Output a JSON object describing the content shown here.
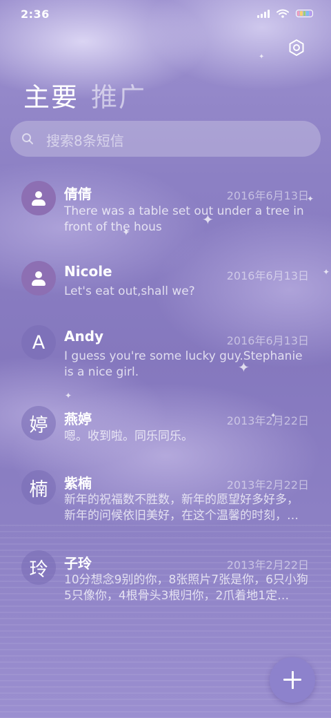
{
  "status_bar": {
    "time": "2:36"
  },
  "tabs": [
    {
      "label": "主要"
    },
    {
      "label": "推广"
    }
  ],
  "search": {
    "placeholder": "搜索8条短信"
  },
  "messages": [
    {
      "name": "倩倩",
      "date": "2016年6月13日",
      "preview": "There was a table set out under a tree in front of the hous",
      "avatar_type": "person",
      "avatar_text": ""
    },
    {
      "name": "Nicole",
      "date": "2016年6月13日",
      "preview": "Let's eat out,shall we?",
      "avatar_type": "person",
      "avatar_text": ""
    },
    {
      "name": "Andy",
      "date": "2016年6月13日",
      "preview": "I guess you're some lucky guy.Stephanie is a nice girl.",
      "avatar_type": "letter",
      "avatar_text": "A"
    },
    {
      "name": "燕婷",
      "date": "2013年2月22日",
      "preview": "嗯。收到啦。同乐同乐。",
      "avatar_type": "letter",
      "avatar_text": "婷"
    },
    {
      "name": "紫楠",
      "date": "2013年2月22日",
      "preview": "新年的祝福数不胜数，新年的愿望好多好多，新年的问候依旧美好，在这个温馨的时刻，…",
      "avatar_type": "letter",
      "avatar_text": "楠"
    },
    {
      "name": "子玲",
      "date": "2013年2月22日",
      "preview": "10分想念9别的你，8张照片7张是你，6只小狗5只像你，4根骨头3根归你，2爪着地1定…",
      "avatar_type": "letter",
      "avatar_text": "玲"
    }
  ],
  "icons": {
    "settings": "settings-icon",
    "search": "search-icon",
    "compose": "plus-icon",
    "contact": "person-icon"
  },
  "colors": {
    "accent": "#8d82cc",
    "avatar_person": "#8d6fb3",
    "battery": [
      "#f0a0c0",
      "#f6d070",
      "#9ad27a",
      "#7ec0f0",
      "#b69af0"
    ]
  }
}
